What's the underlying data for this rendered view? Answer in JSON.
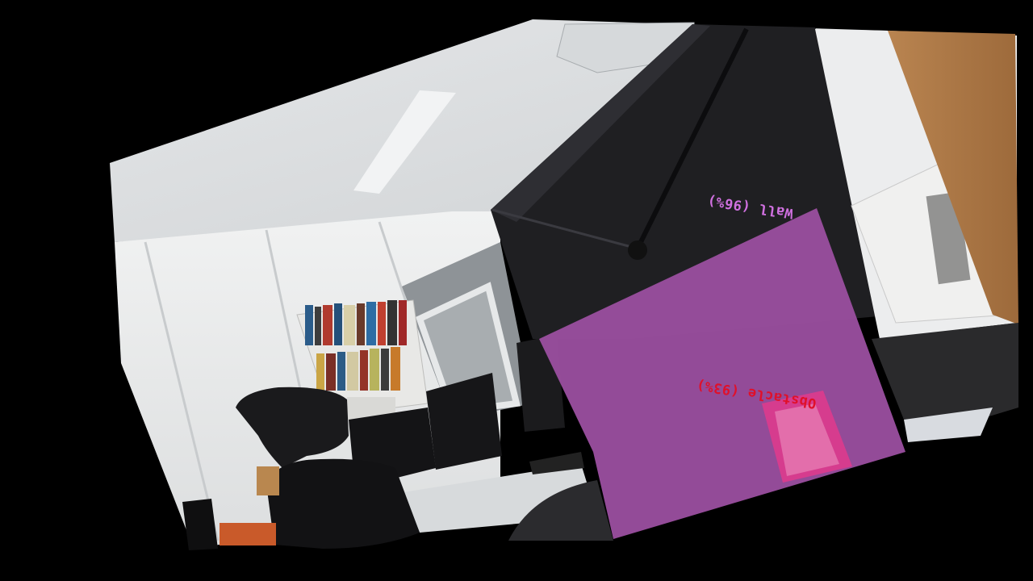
{
  "colors": {
    "background": "#000000",
    "wall_mask": "#9b4fa0",
    "wall_label": "#d070e0",
    "obstacle_mask": "#e23a8c",
    "obstacle_label": "#e0102a"
  },
  "detections": [
    {
      "class": "Wall",
      "confidence": "96%",
      "label": "Wall (96%)"
    },
    {
      "class": "Obstacle",
      "confidence": "93%",
      "label": "Obstacle (93%)"
    }
  ]
}
